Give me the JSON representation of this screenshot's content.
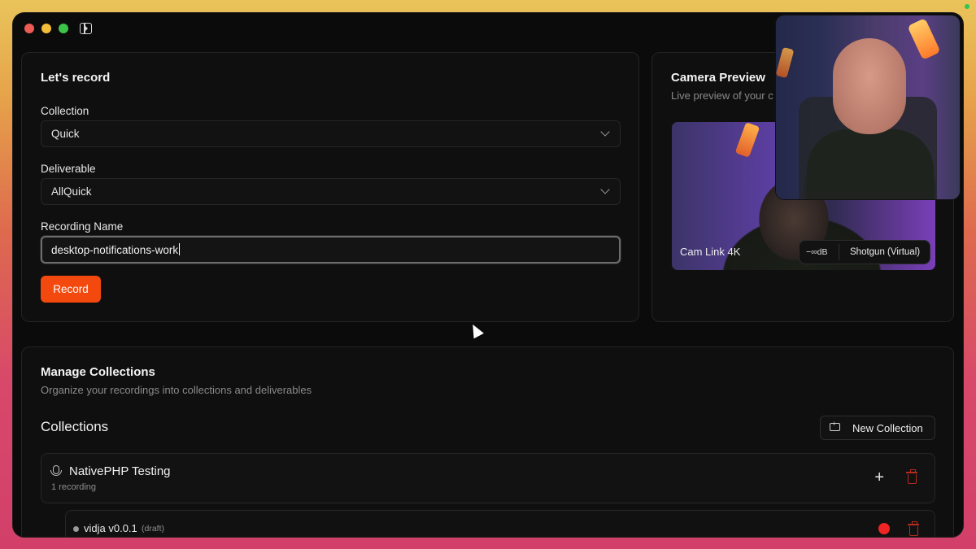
{
  "record": {
    "title": "Let's record",
    "collection_label": "Collection",
    "collection_value": "Quick",
    "deliverable_label": "Deliverable",
    "deliverable_value": "AllQuick",
    "name_label": "Recording Name",
    "name_value": "desktop-notifications-work",
    "record_button": "Record"
  },
  "camera": {
    "title": "Camera Preview",
    "subtitle": "Live preview of your c",
    "device_name": "Cam Link 4K",
    "audio_level": "−∞dB",
    "audio_source": "Shotgun (Virtual)"
  },
  "manage": {
    "title": "Manage Collections",
    "subtitle": "Organize your recordings into collections and deliverables",
    "collections_heading": "Collections",
    "new_collection_button": "New Collection",
    "collections": [
      {
        "name": "NativePHP Testing",
        "count": "1 recording",
        "icon": "microphone-icon",
        "deliverables": [
          {
            "name": "vidja v0.0.1",
            "tag": "(draft)"
          }
        ]
      }
    ]
  },
  "colors": {
    "accent": "#f3490f",
    "record_dot": "#ef2424",
    "trash": "#b32a1f",
    "background": "#0b0b0b"
  }
}
